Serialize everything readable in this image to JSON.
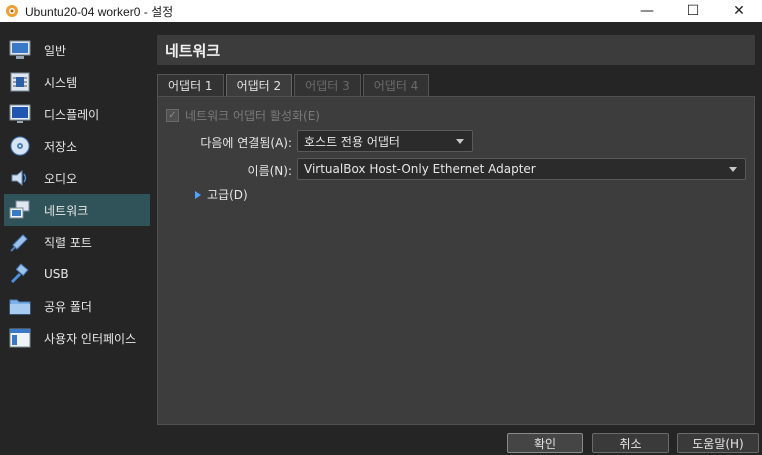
{
  "window": {
    "title": "Ubuntu20-04 worker0 - 설정",
    "minimize": "—",
    "maximize": "☐",
    "close": "✕"
  },
  "sidebar": {
    "items": [
      {
        "label": "일반",
        "icon": "general-icon"
      },
      {
        "label": "시스템",
        "icon": "system-icon"
      },
      {
        "label": "디스플레이",
        "icon": "display-icon"
      },
      {
        "label": "저장소",
        "icon": "storage-icon"
      },
      {
        "label": "오디오",
        "icon": "audio-icon"
      },
      {
        "label": "네트워크",
        "icon": "network-icon",
        "active": true
      },
      {
        "label": "직렬 포트",
        "icon": "serial-port-icon"
      },
      {
        "label": "USB",
        "icon": "usb-icon"
      },
      {
        "label": "공유 폴더",
        "icon": "shared-folder-icon"
      },
      {
        "label": "사용자 인터페이스",
        "icon": "user-interface-icon"
      }
    ]
  },
  "main": {
    "header": "네트워크",
    "tabs": [
      {
        "label": "어댑터 1"
      },
      {
        "label": "어댑터 2",
        "active": true
      },
      {
        "label": "어댑터 3",
        "disabled": true
      },
      {
        "label": "어댑터 4",
        "disabled": true
      }
    ],
    "enable_adapter_label": "네트워크 어댑터 활성화(E)",
    "attached_to_label": "다음에 연결됨(A):",
    "attached_to_value": "호스트 전용 어댑터",
    "name_label": "이름(N):",
    "name_value": "VirtualBox Host-Only Ethernet Adapter",
    "advanced_label": "고급(D)"
  },
  "buttons": {
    "ok": "확인",
    "cancel": "취소",
    "help": "도움말(H)"
  },
  "colors": {
    "accent_selected": "#2f5358",
    "link_triangle": "#4fa3ff"
  }
}
